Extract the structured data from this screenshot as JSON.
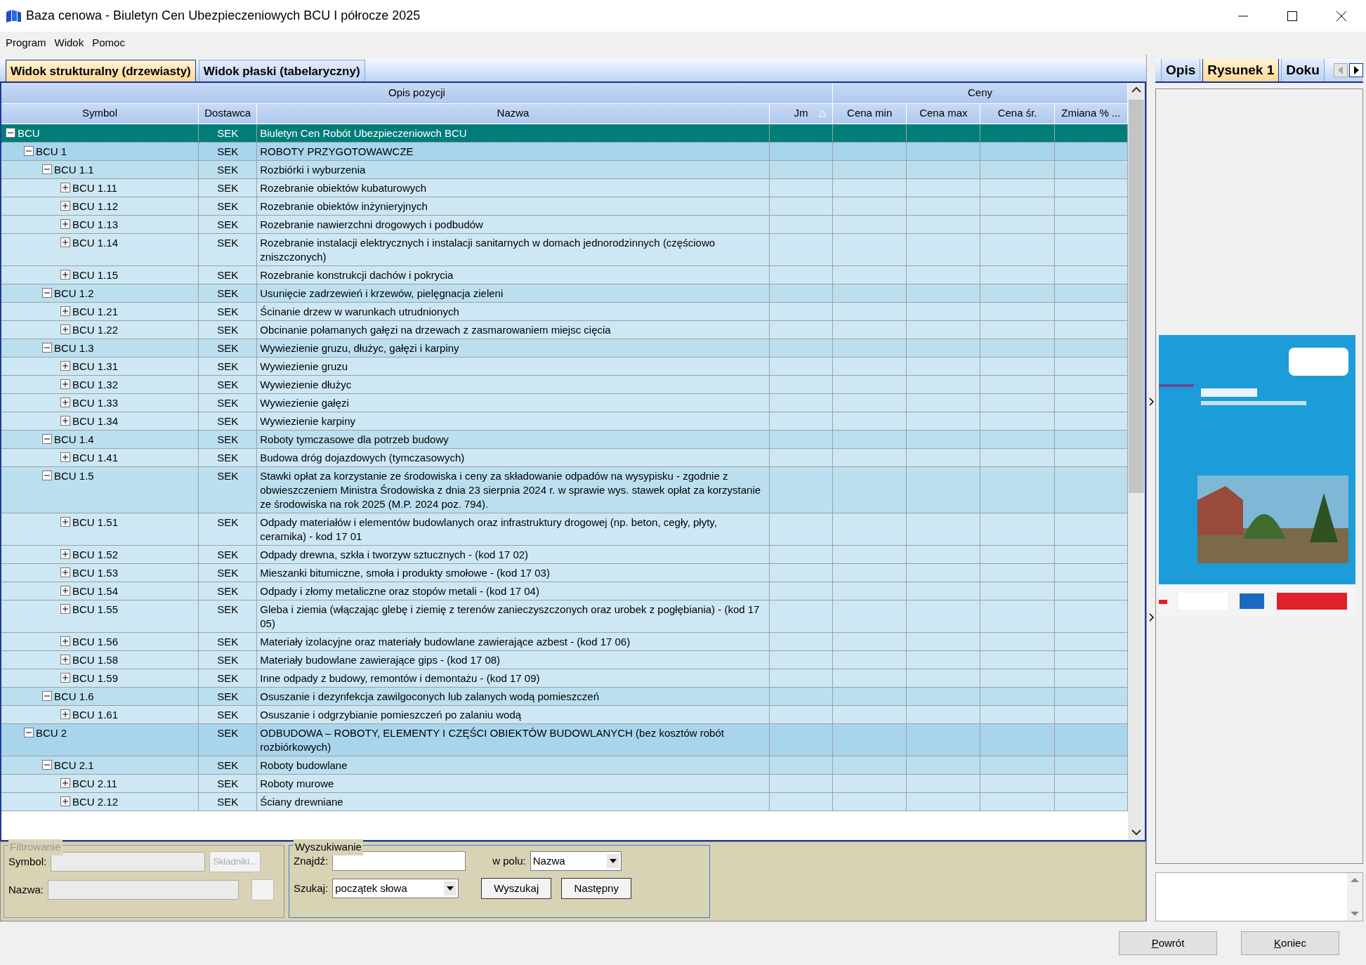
{
  "window": {
    "title": "Baza cenowa - Biuletyn Cen Ubezpieczeniowych BCU I półrocze 2025"
  },
  "menu": [
    "Program",
    "Widok",
    "Pomoc"
  ],
  "view_tabs": [
    {
      "label": "Widok strukturalny (drzewiasty)",
      "selected": true
    },
    {
      "label": "Widok płaski (tabelaryczny)",
      "selected": false
    }
  ],
  "table": {
    "column_groups": [
      {
        "label": "Opis pozycji",
        "columns": [
          {
            "label": "Symbol"
          },
          {
            "label": "Dostawca"
          },
          {
            "label": "Nazwa"
          },
          {
            "label": "Jm",
            "sort_ascending": true
          }
        ]
      },
      {
        "label": "Ceny",
        "columns": [
          {
            "label": "Cena min"
          },
          {
            "label": "Cena max"
          },
          {
            "label": "Cena śr."
          },
          {
            "label": "Zmiana % ..."
          }
        ]
      }
    ],
    "rows": [
      {
        "symbol": "BCU",
        "supplier": "SEK",
        "name": "Biuletyn Cen Robót Ubezpieczeniowch BCU",
        "expanded": true,
        "selected": true,
        "children": [
          {
            "symbol": "BCU 1",
            "supplier": "SEK",
            "name": "ROBOTY PRZYGOTOWAWCZE",
            "expanded": true,
            "selected": false,
            "children": [
              {
                "symbol": "BCU 1.1",
                "supplier": "SEK",
                "name": "Rozbiórki i wyburzenia",
                "expanded": true,
                "selected": false,
                "children": [
                  {
                    "symbol": "BCU 1.11",
                    "supplier": "SEK",
                    "name": "Rozebranie obiektów kubaturowych",
                    "expanded": false,
                    "selected": false
                  },
                  {
                    "symbol": "BCU 1.12",
                    "supplier": "SEK",
                    "name": "Rozebranie obiektów inżynieryjnych",
                    "expanded": false,
                    "selected": false
                  },
                  {
                    "symbol": "BCU 1.13",
                    "supplier": "SEK",
                    "name": "Rozebranie nawierzchni drogowych i podbudów",
                    "expanded": false,
                    "selected": false
                  },
                  {
                    "symbol": "BCU 1.14",
                    "supplier": "SEK",
                    "name": "Rozebranie instalacji elektrycznych i instalacji sanitarnych w domach jednorodzinnych (częściowo zniszczonych)",
                    "expanded": false,
                    "selected": false
                  },
                  {
                    "symbol": "BCU 1.15",
                    "supplier": "SEK",
                    "name": "Rozebranie konstrukcji dachów i pokrycia",
                    "expanded": false,
                    "selected": false
                  }
                ]
              },
              {
                "symbol": "BCU 1.2",
                "supplier": "SEK",
                "name": "Usunięcie zadrzewień i krzewów, pielęgnacja zieleni",
                "expanded": true,
                "selected": false,
                "children": [
                  {
                    "symbol": "BCU 1.21",
                    "supplier": "SEK",
                    "name": "Ścinanie drzew w warunkach utrudnionych",
                    "expanded": false,
                    "selected": false
                  },
                  {
                    "symbol": "BCU 1.22",
                    "supplier": "SEK",
                    "name": "Obcinanie połamanych gałęzi na drzewach z zasmarowaniem miejsc cięcia",
                    "expanded": false,
                    "selected": false
                  }
                ]
              },
              {
                "symbol": "BCU 1.3",
                "supplier": "SEK",
                "name": "Wywiezienie gruzu, dłużyc, gałęzi i karpiny",
                "expanded": true,
                "selected": false,
                "children": [
                  {
                    "symbol": "BCU 1.31",
                    "supplier": "SEK",
                    "name": "Wywiezienie gruzu",
                    "expanded": false,
                    "selected": false
                  },
                  {
                    "symbol": "BCU 1.32",
                    "supplier": "SEK",
                    "name": "Wywiezienie dłużyc",
                    "expanded": false,
                    "selected": false
                  },
                  {
                    "symbol": "BCU 1.33",
                    "supplier": "SEK",
                    "name": "Wywiezienie gałęzi",
                    "expanded": false,
                    "selected": false
                  },
                  {
                    "symbol": "BCU 1.34",
                    "supplier": "SEK",
                    "name": "Wywiezienie karpiny",
                    "expanded": false,
                    "selected": false
                  }
                ]
              },
              {
                "symbol": "BCU 1.4",
                "supplier": "SEK",
                "name": "Roboty tymczasowe dla potrzeb budowy",
                "expanded": true,
                "selected": false,
                "children": [
                  {
                    "symbol": "BCU 1.41",
                    "supplier": "SEK",
                    "name": "Budowa dróg dojazdowych (tymczasowych)",
                    "expanded": false,
                    "selected": false
                  }
                ]
              },
              {
                "symbol": "BCU 1.5",
                "supplier": "SEK",
                "name": "Stawki opłat za korzystanie ze środowiska i ceny za składowanie odpadów na wysypisku - zgodnie z obwieszczeniem Ministra Środowiska z dnia 23 sierpnia 2024 r. w sprawie wys. stawek opłat za korzystanie ze środowiska na rok 2025 (M.P. 2024 poz. 794).",
                "expanded": true,
                "selected": false,
                "children": [
                  {
                    "symbol": "BCU 1.51",
                    "supplier": "SEK",
                    "name": "Odpady materiałów i elementów budowlanych oraz infrastruktury drogowej (np. beton, cegły, płyty, ceramika) - kod 17 01",
                    "expanded": false,
                    "selected": false
                  },
                  {
                    "symbol": "BCU 1.52",
                    "supplier": "SEK",
                    "name": "Odpady drewna, szkła i tworzyw sztucznych - (kod 17 02)",
                    "expanded": false,
                    "selected": false
                  },
                  {
                    "symbol": "BCU 1.53",
                    "supplier": "SEK",
                    "name": "Mieszanki bitumiczne, smoła i produkty smołowe - (kod 17 03)",
                    "expanded": false,
                    "selected": false
                  },
                  {
                    "symbol": "BCU 1.54",
                    "supplier": "SEK",
                    "name": "Odpady i złomy metaliczne oraz stopów metali - (kod 17 04)",
                    "expanded": false,
                    "selected": false
                  },
                  {
                    "symbol": "BCU 1.55",
                    "supplier": "SEK",
                    "name": "Gleba i ziemia (włączając glebę i ziemię z terenów zanieczyszczonych oraz urobek z pogłębiania) - (kod 17 05)",
                    "expanded": false,
                    "selected": false
                  },
                  {
                    "symbol": "BCU 1.56",
                    "supplier": "SEK",
                    "name": "Materiały izolacyjne oraz materiały budowlane zawierające azbest - (kod 17 06)",
                    "expanded": false,
                    "selected": false
                  },
                  {
                    "symbol": "BCU 1.58",
                    "supplier": "SEK",
                    "name": "Materiały budowlane zawierające gips - (kod 17 08)",
                    "expanded": false,
                    "selected": false
                  },
                  {
                    "symbol": "BCU 1.59",
                    "supplier": "SEK",
                    "name": "Inne odpady z budowy, remontów i demontażu - (kod 17 09)",
                    "expanded": false,
                    "selected": false
                  }
                ]
              },
              {
                "symbol": "BCU 1.6",
                "supplier": "SEK",
                "name": "Osuszanie i dezynfekcja zawilgoconych lub zalanych wodą pomieszczeń",
                "expanded": true,
                "selected": false,
                "children": [
                  {
                    "symbol": "BCU 1.61",
                    "supplier": "SEK",
                    "name": "Osuszanie i odgrzybianie pomieszczeń po zalaniu wodą",
                    "expanded": false,
                    "selected": false
                  }
                ]
              }
            ]
          },
          {
            "symbol": "BCU 2",
            "supplier": "SEK",
            "name": "ODBUDOWA – ROBOTY, ELEMENTY I CZĘŚCI OBIEKTÓW BUDOWLANYCH (bez kosztów robót rozbiórkowych)",
            "expanded": true,
            "selected": false,
            "children": [
              {
                "symbol": "BCU 2.1",
                "supplier": "SEK",
                "name": "Roboty budowlane",
                "expanded": true,
                "selected": false,
                "children": [
                  {
                    "symbol": "BCU 2.11",
                    "supplier": "SEK",
                    "name": "Roboty murowe",
                    "expanded": false,
                    "selected": false
                  },
                  {
                    "symbol": "BCU 2.12",
                    "supplier": "SEK",
                    "name": "Ściany drewniane",
                    "expanded": false,
                    "selected": false
                  }
                ]
              }
            ]
          }
        ]
      }
    ]
  },
  "filter": {
    "title": "Filtrowanie",
    "disabled": true,
    "symbol_label": "Symbol:",
    "name_label": "Nazwa:",
    "button": "Składniki..."
  },
  "search": {
    "title": "Wyszukiwanie",
    "find_label": "Znajdź:",
    "field_label": "w polu:",
    "field_value": "Nazwa",
    "mode_label": "Szukaj:",
    "mode_value": "początek słowa",
    "buttons": [
      "Wyszukaj",
      "Następny"
    ]
  },
  "side_tabs": [
    {
      "label": "Opis",
      "selected": false
    },
    {
      "label": "Rysunek 1",
      "selected": true
    },
    {
      "label": "Doku",
      "selected": false
    }
  ],
  "footer_buttons": [
    "Powrót",
    "Koniec"
  ]
}
